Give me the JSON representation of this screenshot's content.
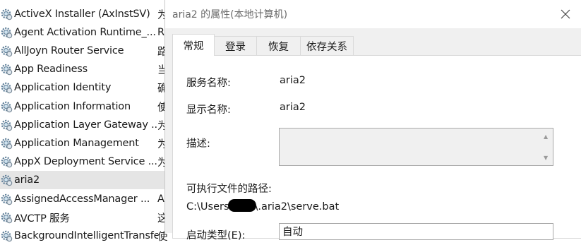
{
  "services": [
    {
      "name": "ActiveX Installer (AxInstSV)",
      "desc": "为"
    },
    {
      "name": "Agent Activation Runtime_...",
      "desc": "R"
    },
    {
      "name": "AllJoyn Router Service",
      "desc": "路"
    },
    {
      "name": "App Readiness",
      "desc": "当"
    },
    {
      "name": "Application Identity",
      "desc": "确"
    },
    {
      "name": "Application Information",
      "desc": "使"
    },
    {
      "name": "Application Layer Gateway ...",
      "desc": "为"
    },
    {
      "name": "Application Management",
      "desc": "为"
    },
    {
      "name": "AppX Deployment Service ...",
      "desc": "为"
    },
    {
      "name": "aria2",
      "desc": ""
    },
    {
      "name": "AssignedAccessManager ...",
      "desc": "A"
    },
    {
      "name": "AVCTP 服务",
      "desc": "这"
    },
    {
      "name": "BackgroundIntelligentTransfer...",
      "desc": "使"
    }
  ],
  "dialog": {
    "title": "aria2 的属性(本地计算机)",
    "tabs": [
      "常规",
      "登录",
      "恢复",
      "依存关系"
    ],
    "service_name_label": "服务名称:",
    "service_name_value": "aria2",
    "display_name_label": "显示名称:",
    "display_name_value": "aria2",
    "description_label": "描述:",
    "description_value": "",
    "exe_path_label": "可执行文件的路径:",
    "exe_path_prefix": "C:\\Users",
    "exe_path_suffix": "\\.aria2\\serve.bat",
    "startup_type_label": "启动类型(E):",
    "startup_type_value": "自动"
  },
  "icons": {
    "service": "gear-icon",
    "close": "close-icon"
  },
  "colors": {
    "selected_row": "#e5e5e5",
    "dialog_bg": "#f0f0f0"
  }
}
